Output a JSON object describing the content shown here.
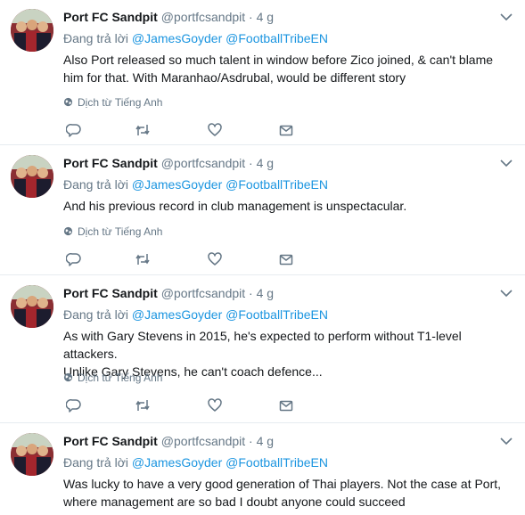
{
  "tweets": [
    {
      "author": {
        "name": "Port FC Sandpit",
        "handle": "@portfcsandpit"
      },
      "separator": "·",
      "time": "4 g",
      "reply_prefix": "Đang trả lời",
      "mentions": [
        "@JamesGoyder",
        "@FootballTribeEN"
      ],
      "lines": [
        "Also Port released so much talent in window before Zico joined, & can't blame",
        "him for that. With Maranhao/Asdrubal, would be different story"
      ],
      "translate": "Dịch từ Tiếng Anh"
    },
    {
      "author": {
        "name": "Port FC Sandpit",
        "handle": "@portfcsandpit"
      },
      "separator": "·",
      "time": "4 g",
      "reply_prefix": "Đang trả lời",
      "mentions": [
        "@JamesGoyder",
        "@FootballTribeEN"
      ],
      "lines": [
        "And his previous record in club management is unspectacular."
      ],
      "translate": "Dịch từ Tiếng Anh"
    },
    {
      "author": {
        "name": "Port FC Sandpit",
        "handle": "@portfcsandpit"
      },
      "separator": "·",
      "time": "4 g",
      "reply_prefix": "Đang trả lời",
      "mentions": [
        "@JamesGoyder",
        "@FootballTribeEN"
      ],
      "lines": [
        "As with Gary Stevens in 2015, he's expected to perform without T1-level attackers.",
        "Unlike Gary Stevens, he can't coach defence..."
      ],
      "translate": "Dịch từ Tiếng Anh"
    },
    {
      "author": {
        "name": "Port FC Sandpit",
        "handle": "@portfcsandpit"
      },
      "separator": "·",
      "time": "4 g",
      "reply_prefix": "Đang trả lời",
      "mentions": [
        "@JamesGoyder",
        "@FootballTribeEN"
      ],
      "lines": [
        "Was lucky to have a very good generation of Thai players. Not the case at Port,",
        "where management are so bad I doubt anyone could succeed"
      ]
    }
  ],
  "icons": {
    "caret": "chevron-down-icon",
    "translate": "globe-icon",
    "actions": [
      "reply-icon",
      "retweet-icon",
      "like-icon",
      "message-icon"
    ]
  },
  "colors": {
    "link": "#1b95e0",
    "muted": "#657786",
    "text": "#14171a",
    "divider": "#e6ecf0"
  }
}
